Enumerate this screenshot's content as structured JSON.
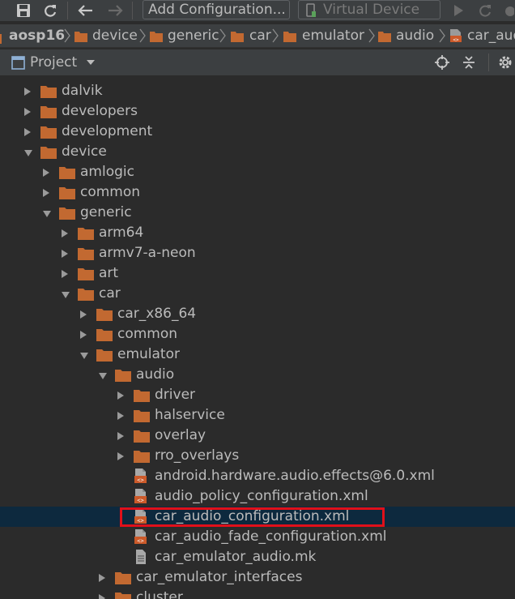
{
  "toolbar": {
    "config_label": "Add Configuration...",
    "device_label": "Virtual Device"
  },
  "breadcrumbs": [
    "aosp16",
    "device",
    "generic",
    "car",
    "emulator",
    "audio",
    "car_aud"
  ],
  "panel": {
    "title": "Project"
  },
  "tree": {
    "items": [
      {
        "label": "dalvik",
        "depth": 0,
        "kind": "folder",
        "state": "collapsed"
      },
      {
        "label": "developers",
        "depth": 0,
        "kind": "folder",
        "state": "collapsed"
      },
      {
        "label": "development",
        "depth": 0,
        "kind": "folder",
        "state": "collapsed"
      },
      {
        "label": "device",
        "depth": 0,
        "kind": "folder",
        "state": "expanded"
      },
      {
        "label": "amlogic",
        "depth": 1,
        "kind": "folder",
        "state": "collapsed"
      },
      {
        "label": "common",
        "depth": 1,
        "kind": "folder",
        "state": "collapsed"
      },
      {
        "label": "generic",
        "depth": 1,
        "kind": "folder",
        "state": "expanded"
      },
      {
        "label": "arm64",
        "depth": 2,
        "kind": "folder",
        "state": "collapsed"
      },
      {
        "label": "armv7-a-neon",
        "depth": 2,
        "kind": "folder",
        "state": "collapsed"
      },
      {
        "label": "art",
        "depth": 2,
        "kind": "folder",
        "state": "collapsed"
      },
      {
        "label": "car",
        "depth": 2,
        "kind": "folder",
        "state": "expanded"
      },
      {
        "label": "car_x86_64",
        "depth": 3,
        "kind": "folder",
        "state": "collapsed"
      },
      {
        "label": "common",
        "depth": 3,
        "kind": "folder",
        "state": "collapsed"
      },
      {
        "label": "emulator",
        "depth": 3,
        "kind": "folder",
        "state": "expanded"
      },
      {
        "label": "audio",
        "depth": 4,
        "kind": "folder",
        "state": "expanded"
      },
      {
        "label": "driver",
        "depth": 5,
        "kind": "folder",
        "state": "collapsed"
      },
      {
        "label": "halservice",
        "depth": 5,
        "kind": "folder",
        "state": "collapsed"
      },
      {
        "label": "overlay",
        "depth": 5,
        "kind": "folder",
        "state": "collapsed"
      },
      {
        "label": "rro_overlays",
        "depth": 5,
        "kind": "folder",
        "state": "collapsed"
      },
      {
        "label": "android.hardware.audio.effects@6.0.xml",
        "depth": 5,
        "kind": "xml",
        "state": "none"
      },
      {
        "label": "audio_policy_configuration.xml",
        "depth": 5,
        "kind": "xml",
        "state": "none"
      },
      {
        "label": "car_audio_configuration.xml",
        "depth": 5,
        "kind": "xml",
        "state": "none",
        "selected": true
      },
      {
        "label": "car_audio_fade_configuration.xml",
        "depth": 5,
        "kind": "xml",
        "state": "none"
      },
      {
        "label": "car_emulator_audio.mk",
        "depth": 5,
        "kind": "text",
        "state": "none"
      },
      {
        "label": "car_emulator_interfaces",
        "depth": 4,
        "kind": "folder",
        "state": "collapsed"
      },
      {
        "label": "cluster",
        "depth": 4,
        "kind": "folder",
        "state": "collapsed"
      }
    ]
  },
  "colors": {
    "background": "#2b2b2b",
    "chrome": "#3c3f41",
    "selection": "#0d293e",
    "folder": "#c26931",
    "xml_badge": "#cc5a2a",
    "highlight_box": "#e0101a",
    "text": "#bbbbbb"
  }
}
